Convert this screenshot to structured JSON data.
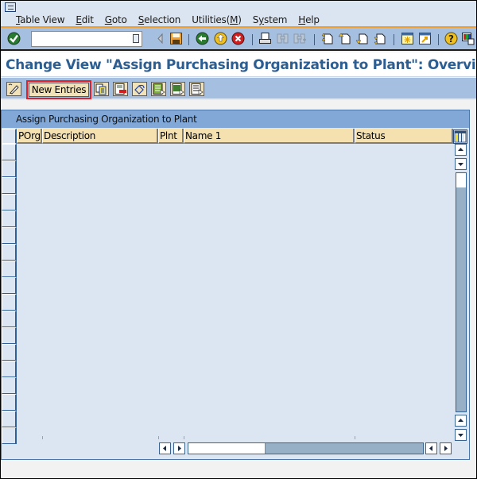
{
  "window": {
    "system_menu_icon": "system-menu-icon"
  },
  "menu": {
    "items": [
      {
        "label": "Table View",
        "mnemonic": "T",
        "rest": "able View"
      },
      {
        "label": "Edit",
        "mnemonic": "E",
        "rest": "dit"
      },
      {
        "label": "Goto",
        "mnemonic": "G",
        "rest": "oto"
      },
      {
        "label": "Selection",
        "mnemonic": "S",
        "rest": "election"
      },
      {
        "label": "Utilities(M)",
        "mnemonic": "M",
        "pre": "Utilities(",
        "post": ")"
      },
      {
        "label": "System",
        "mnemonic": "y",
        "pre": "S",
        "post": "stem"
      },
      {
        "label": "Help",
        "mnemonic": "H",
        "rest": "elp"
      }
    ]
  },
  "system_toolbar": {
    "command_field": {
      "value": "",
      "placeholder": ""
    },
    "icons": [
      "enter-icon",
      "command-dropdown-icon",
      "collapse-icon",
      "save-icon",
      "back-icon",
      "exit-icon",
      "cancel-icon",
      "print-icon",
      "find-icon",
      "find-next-icon",
      "first-page-icon",
      "previous-page-icon",
      "next-page-icon",
      "last-page-icon",
      "create-session-icon",
      "shortcut-icon",
      "help-icon",
      "customize-layout-icon"
    ]
  },
  "header": {
    "title": "Change View \"Assign Purchasing Organization to Plant\": Overview"
  },
  "app_toolbar": {
    "new_entries_label": "New Entries",
    "icons": [
      "display-change-icon",
      "copy-as-icon",
      "delete-icon",
      "undo-change-icon",
      "select-all-icon",
      "select-block-icon",
      "deselect-all-icon"
    ]
  },
  "table": {
    "title": "Assign Purchasing Organization to Plant",
    "columns": [
      "POrg",
      "Description",
      "Plnt",
      "Name 1",
      "Status"
    ],
    "rows": [],
    "visible_empty_rows": 18
  },
  "colors": {
    "title_text": "#2c5e92",
    "toolbar_bg": "#a5bfe1",
    "table_title_bg": "#81a8d6",
    "column_header_bg": "#f5e1b0",
    "table_bg": "#dce6f2",
    "highlight_border": "#e0202a",
    "menu_accent": "#f0a030"
  }
}
